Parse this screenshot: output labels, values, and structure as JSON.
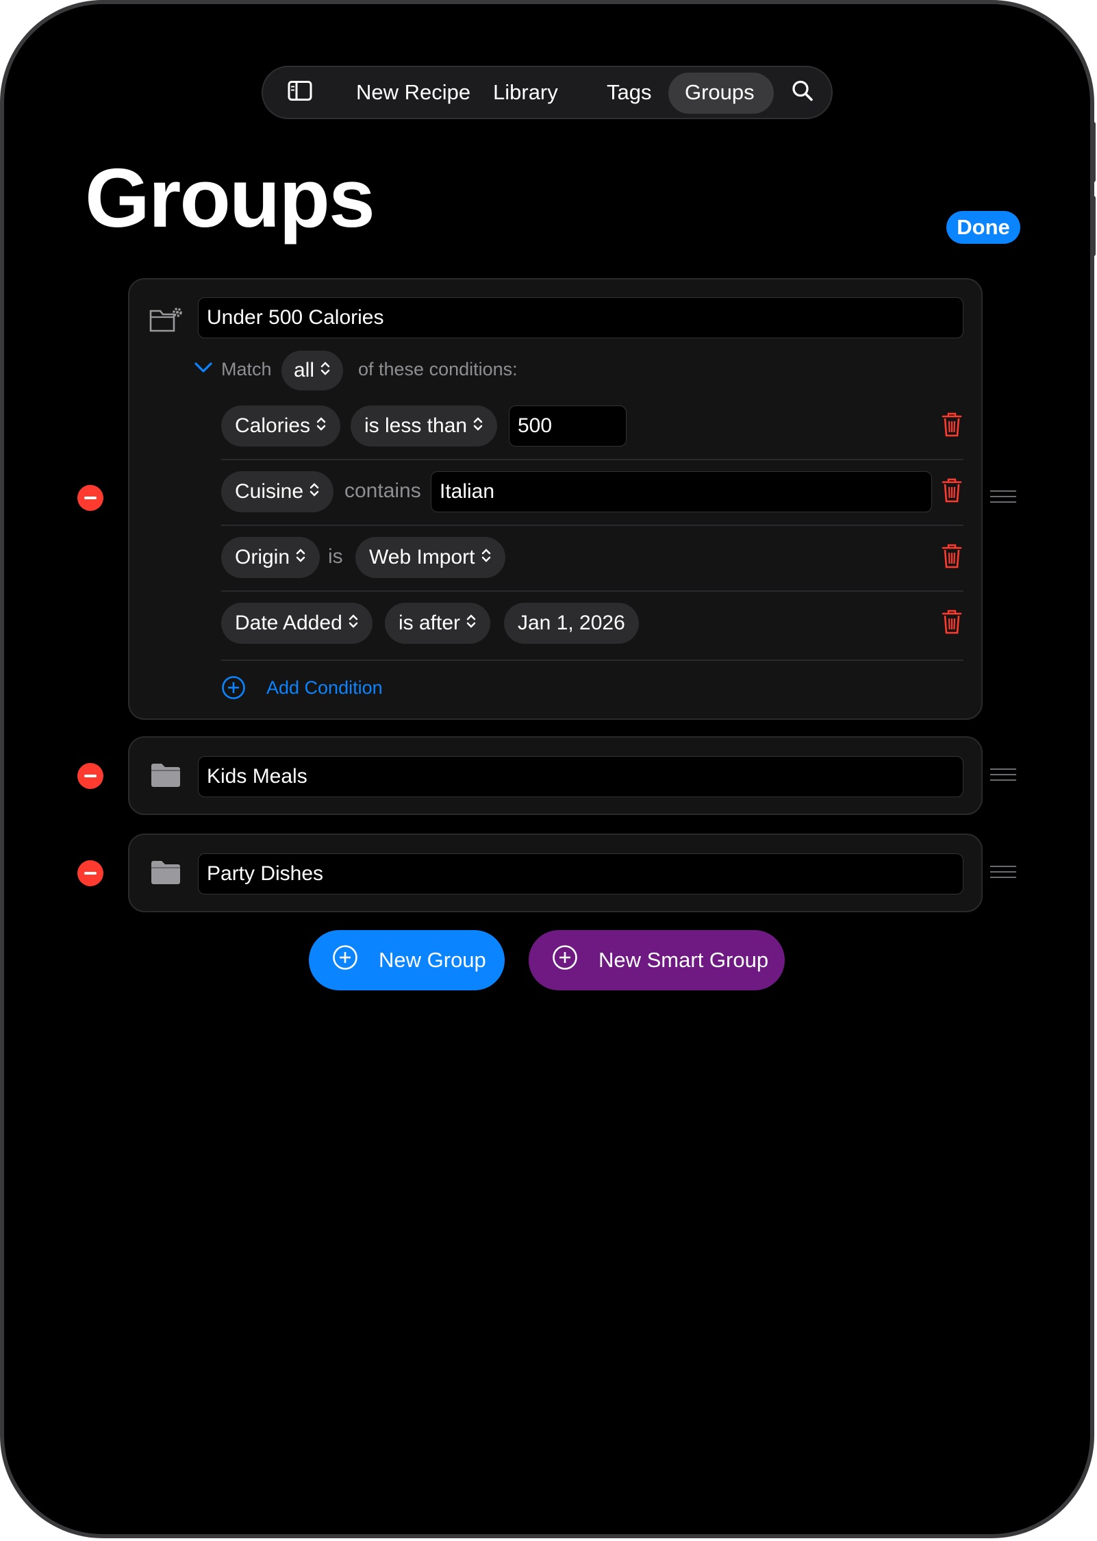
{
  "nav": {
    "items": [
      "New Recipe",
      "Library",
      "Tags",
      "Groups"
    ],
    "active": "Groups"
  },
  "page": {
    "title": "Groups",
    "done_label": "Done"
  },
  "smart_group": {
    "name": "Under 500 Calories",
    "match_label": "Match",
    "match_value": "all",
    "match_suffix": "of these conditions:",
    "conditions": [
      {
        "field": "Calories",
        "operator": "is less than",
        "value": "500"
      },
      {
        "field": "Cuisine",
        "operator": "contains",
        "value": "Italian"
      },
      {
        "field": "Origin",
        "operator": "is",
        "value": "Web Import"
      },
      {
        "field": "Date Added",
        "operator": "is after",
        "value": "Jan 1, 2026"
      }
    ],
    "add_condition_label": "Add Condition"
  },
  "groups": [
    {
      "name": "Kids Meals"
    },
    {
      "name": "Party Dishes"
    }
  ],
  "actions": {
    "new_group_label": "New Group",
    "new_smart_group_label": "New Smart Group"
  },
  "colors": {
    "accent": "#0a84ff",
    "destructive": "#ff3b30",
    "smart_group_button": "#6e1a82"
  }
}
